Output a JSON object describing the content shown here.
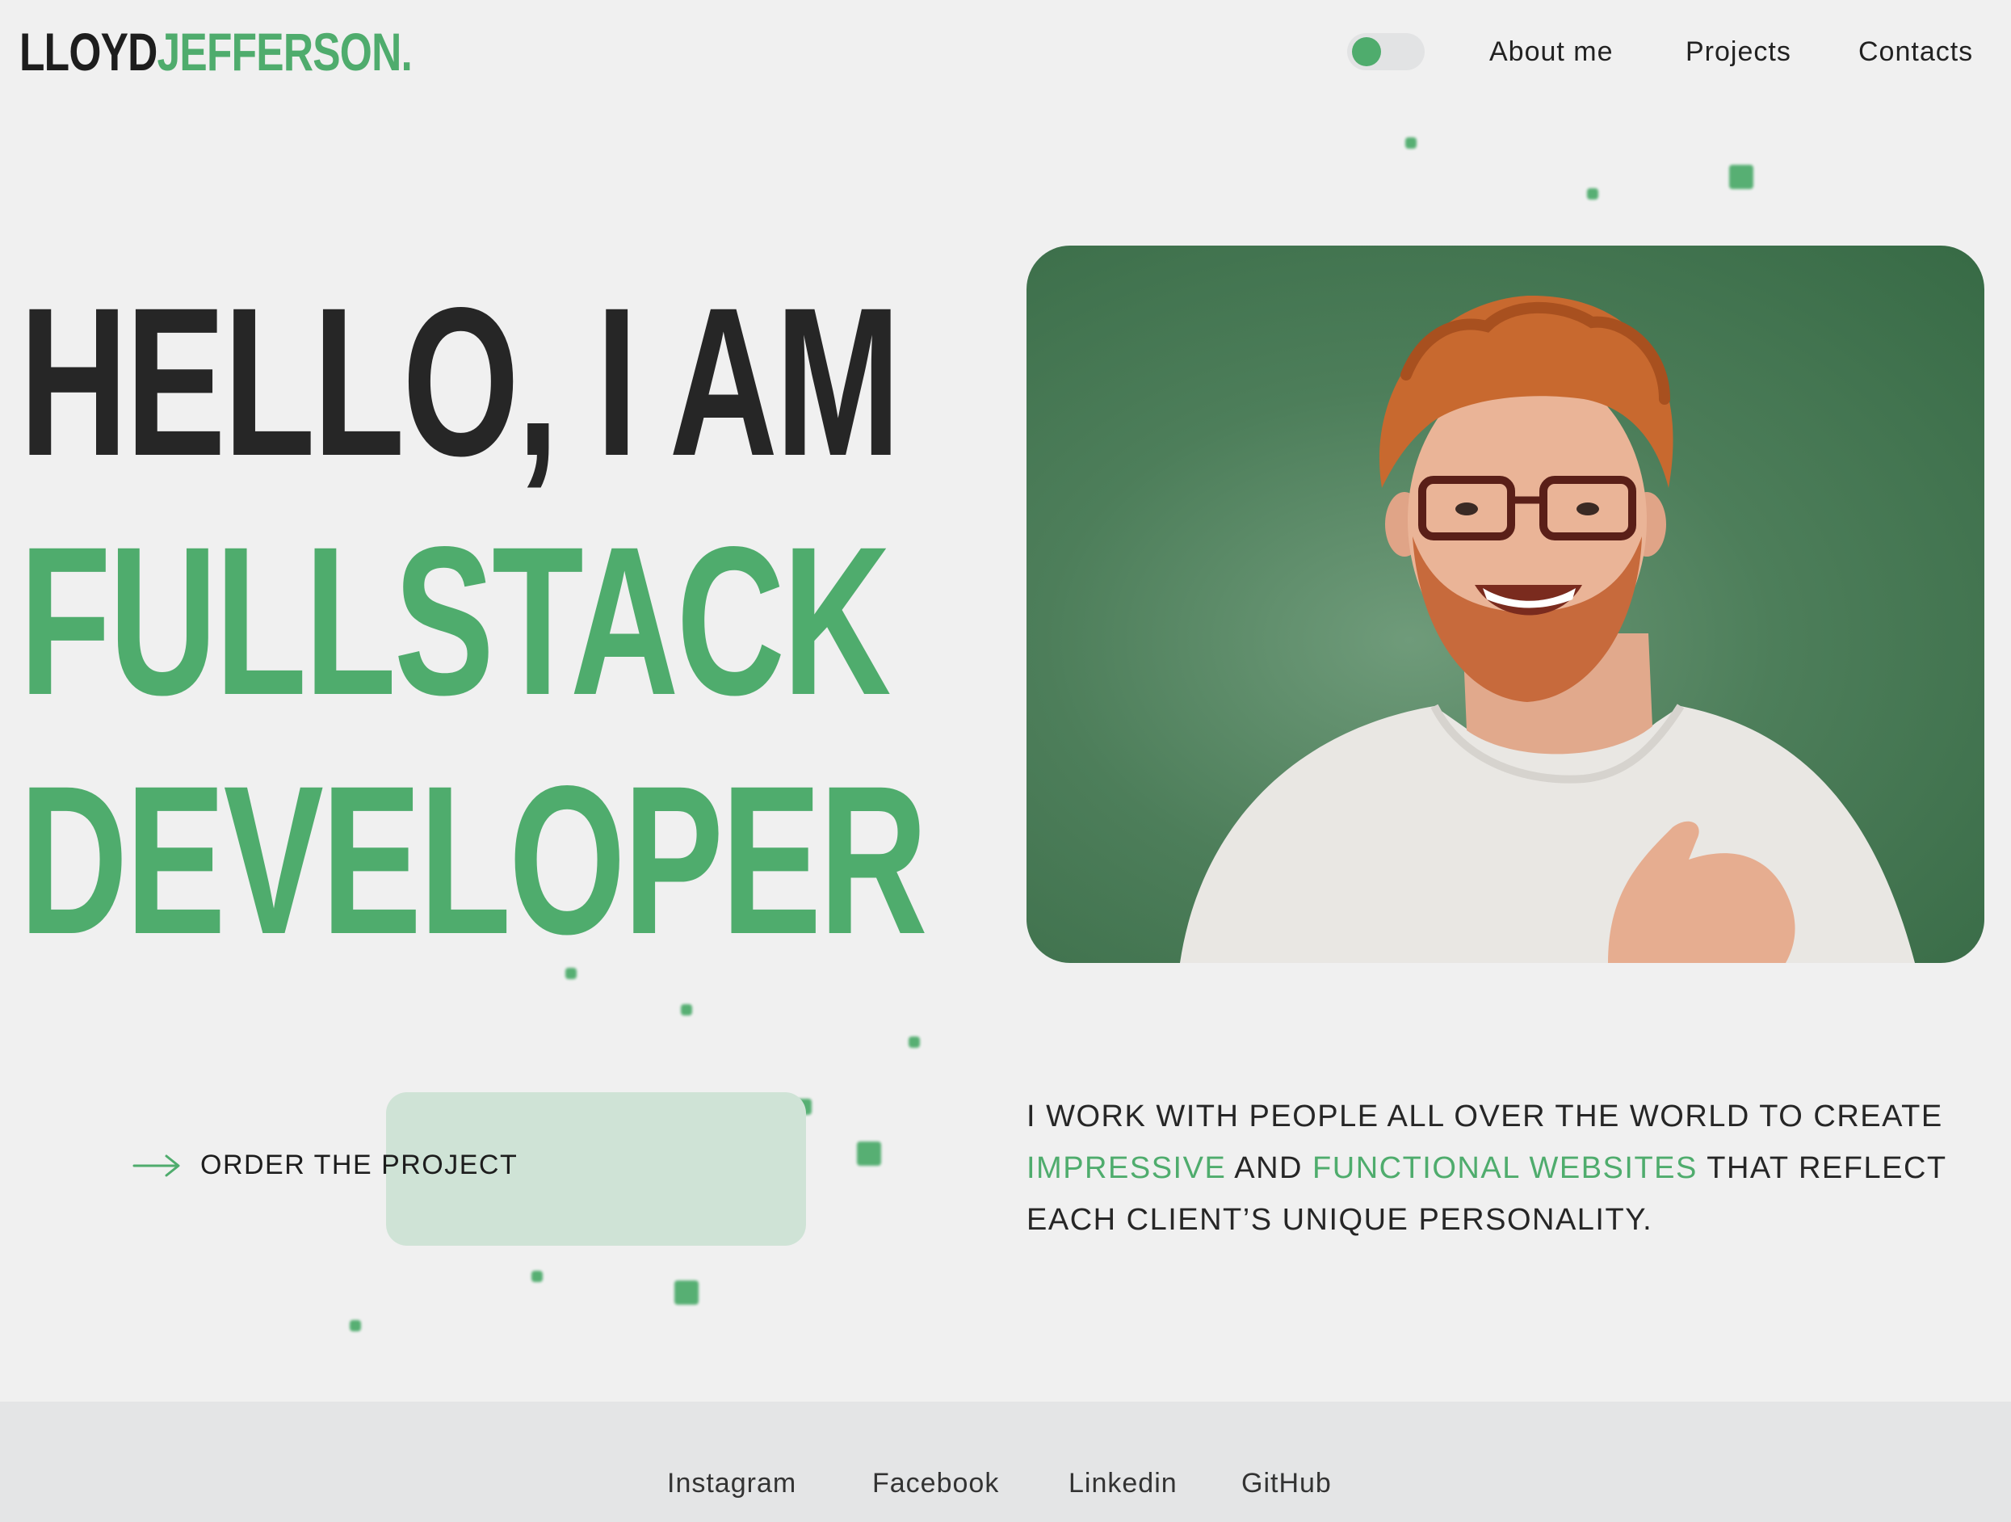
{
  "header": {
    "logo_part1": "LLOYD",
    "logo_part2": "JEFFERSON.",
    "nav": [
      {
        "label": "About me"
      },
      {
        "label": "Projects"
      },
      {
        "label": "Contacts"
      }
    ]
  },
  "hero": {
    "line1": "HELLO, I AM",
    "line2": "FULLSTACK",
    "line3": "DEVELOPER",
    "photo_icon": "portrait-photo"
  },
  "cta": {
    "label": "ORDER THE PROJECT",
    "icon": "arrow-right-icon"
  },
  "description": {
    "part1": "I WORK WITH PEOPLE ALL OVER THE WORLD TO CREATE ",
    "highlight1": "IMPRESSIVE",
    "part2": " AND ",
    "highlight2": "FUNCTIONAL WEBSITES",
    "part3": " THAT REFLECT EACH CLIENT’S UNIQUE PERSONALITY."
  },
  "footer": {
    "links": [
      {
        "label": "Instagram"
      },
      {
        "label": "Facebook"
      },
      {
        "label": "Linkedin"
      },
      {
        "label": "GitHub"
      }
    ]
  },
  "colors": {
    "accent": "#4fac6d",
    "dark": "#262626",
    "background": "#f0f0f0",
    "footer_bg": "#e4e5e6",
    "cta_box": "#cfe3d6"
  }
}
